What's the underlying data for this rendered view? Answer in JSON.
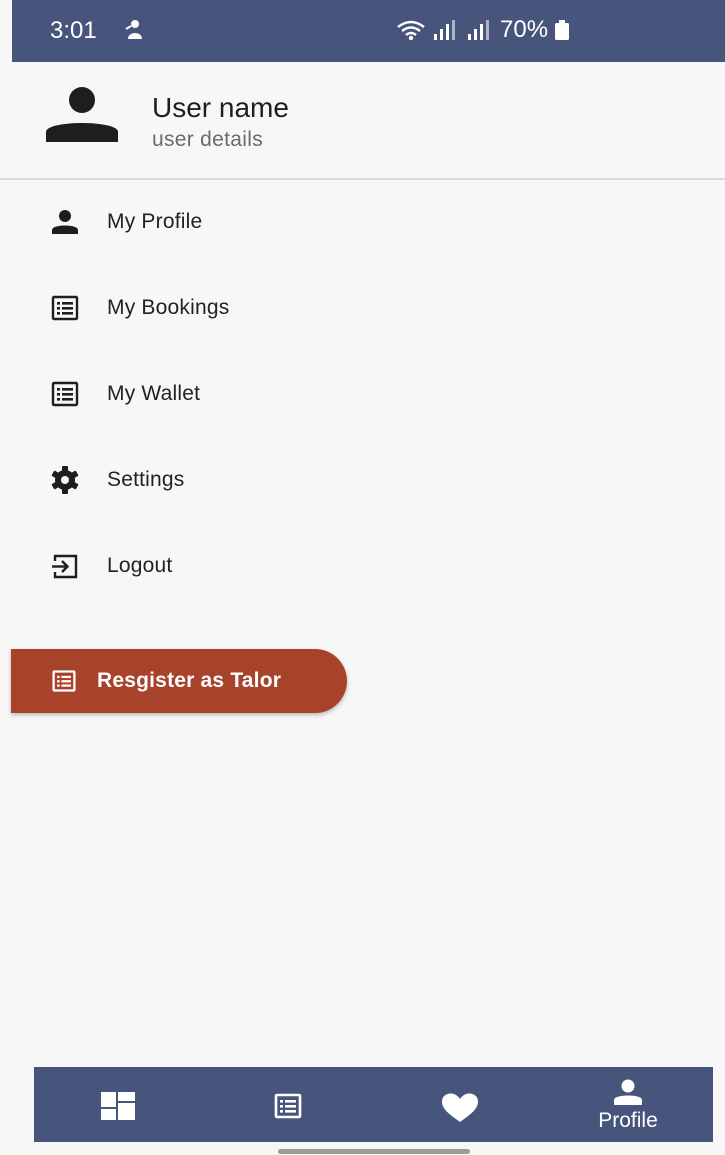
{
  "status_bar": {
    "time": "3:01",
    "battery_percent": "70%",
    "icons": [
      "notification-icon",
      "wifi-icon",
      "signal-icon",
      "battery-icon"
    ]
  },
  "header": {
    "user_name": "User name",
    "user_details": "user details",
    "avatar_icon": "person-icon"
  },
  "menu": {
    "items": [
      {
        "label": "My Profile",
        "icon": "person-icon"
      },
      {
        "label": "My Bookings",
        "icon": "list-icon"
      },
      {
        "label": "My Wallet",
        "icon": "list-icon"
      },
      {
        "label": "Settings",
        "icon": "gear-icon"
      },
      {
        "label": "Logout",
        "icon": "logout-icon"
      }
    ]
  },
  "register_button": {
    "label": "Resgister as Talor",
    "icon": "list-icon"
  },
  "bottom_nav": {
    "items": [
      {
        "icon": "dashboard-icon",
        "label": ""
      },
      {
        "icon": "list-icon",
        "label": ""
      },
      {
        "icon": "heart-icon",
        "label": ""
      },
      {
        "icon": "person-icon",
        "label": "Profile",
        "active": true
      }
    ]
  },
  "colors": {
    "primary": "#47557d",
    "accent": "#a8432b",
    "background": "#f7f7f7",
    "text": "#1e1e1e",
    "secondary_text": "#6b6b6b"
  }
}
